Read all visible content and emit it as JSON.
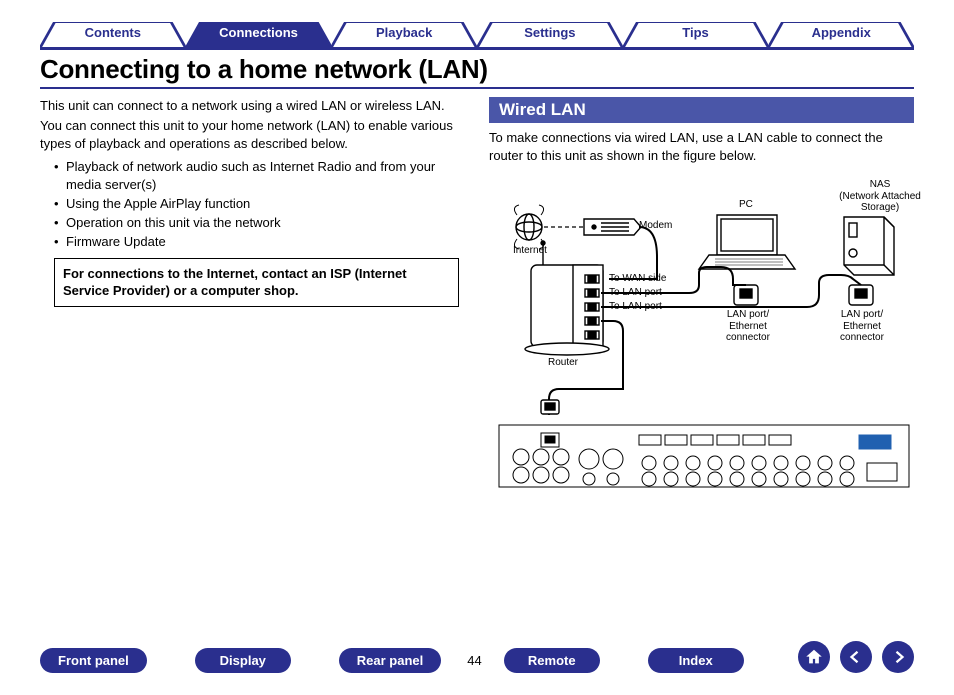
{
  "tabs": [
    {
      "label": "Contents",
      "active": false
    },
    {
      "label": "Connections",
      "active": true
    },
    {
      "label": "Playback",
      "active": false
    },
    {
      "label": "Settings",
      "active": false
    },
    {
      "label": "Tips",
      "active": false
    },
    {
      "label": "Appendix",
      "active": false
    }
  ],
  "title": "Connecting to a home network (LAN)",
  "intro1": "This unit can connect to a network using a wired LAN or wireless LAN.",
  "intro2": "You can connect this unit to your home network (LAN) to enable various types of playback and operations as described below.",
  "bullets": [
    "Playback of network audio such as Internet Radio and from your media server(s)",
    "Using the Apple AirPlay function",
    "Operation on this unit via the network",
    "Firmware Update"
  ],
  "note": "For connections to the Internet, contact an ISP (Internet Service Provider) or a computer shop.",
  "section_title": "Wired LAN",
  "wired_intro": "To make connections via wired LAN, use a LAN cable to connect the router to this unit as shown in the figure below.",
  "diagram": {
    "modem": "Modem",
    "internet": "Internet",
    "pc": "PC",
    "nas1": "NAS",
    "nas2": "(Network Attached",
    "nas3": "Storage)",
    "router": "Router",
    "to_wan": "To WAN side",
    "to_lan1": "To LAN port",
    "to_lan2": "To LAN port",
    "lan_conn1a": "LAN port/",
    "lan_conn1b": "Ethernet",
    "lan_conn1c": "connector",
    "lan_conn2a": "LAN port/",
    "lan_conn2b": "Ethernet",
    "lan_conn2c": "connector"
  },
  "bottom_nav": {
    "front": "Front panel",
    "display": "Display",
    "rear": "Rear panel",
    "remote": "Remote",
    "index": "Index"
  },
  "page_number": "44"
}
